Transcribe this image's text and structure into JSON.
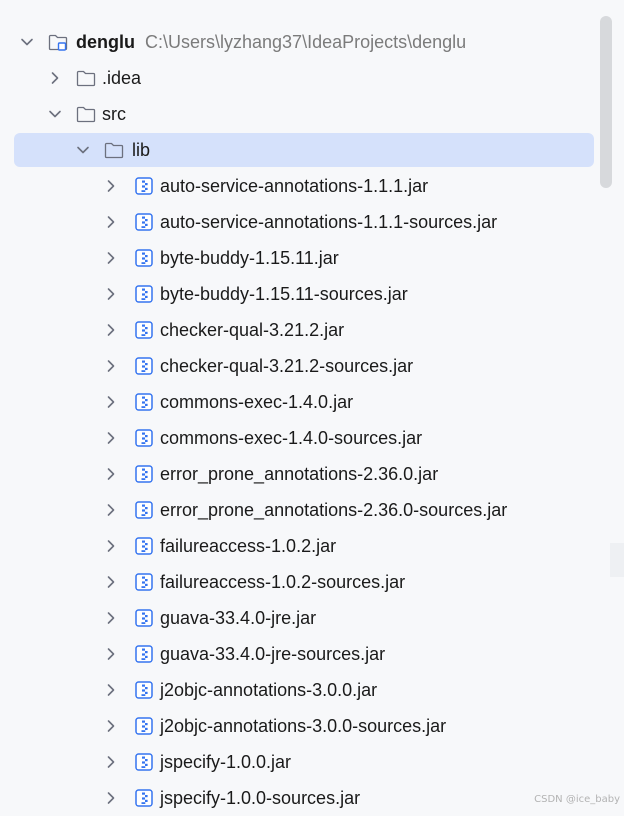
{
  "project": {
    "name": "denglu",
    "path": "C:\\Users\\lyzhang37\\IdeaProjects\\denglu"
  },
  "folders": {
    "idea": ".idea",
    "src": "src",
    "lib": "lib"
  },
  "jars": [
    "auto-service-annotations-1.1.1.jar",
    "auto-service-annotations-1.1.1-sources.jar",
    "byte-buddy-1.15.11.jar",
    "byte-buddy-1.15.11-sources.jar",
    "checker-qual-3.21.2.jar",
    "checker-qual-3.21.2-sources.jar",
    "commons-exec-1.4.0.jar",
    "commons-exec-1.4.0-sources.jar",
    "error_prone_annotations-2.36.0.jar",
    "error_prone_annotations-2.36.0-sources.jar",
    "failureaccess-1.0.2.jar",
    "failureaccess-1.0.2-sources.jar",
    "guava-33.4.0-jre.jar",
    "guava-33.4.0-jre-sources.jar",
    "j2objc-annotations-3.0.0.jar",
    "j2objc-annotations-3.0.0-sources.jar",
    "jspecify-1.0.0.jar",
    "jspecify-1.0.0-sources.jar"
  ],
  "watermark": "CSDN @ice_baby",
  "colors": {
    "background": "#f7f8fa",
    "selection": "#d5e1fb",
    "path_text": "#7b7b7b",
    "jar_icon": "#3574f0"
  },
  "icons": {
    "expanded": "chevron-down-icon",
    "collapsed": "chevron-right-icon",
    "project": "project-folder-icon",
    "folder": "folder-icon",
    "jar": "jar-file-icon"
  }
}
